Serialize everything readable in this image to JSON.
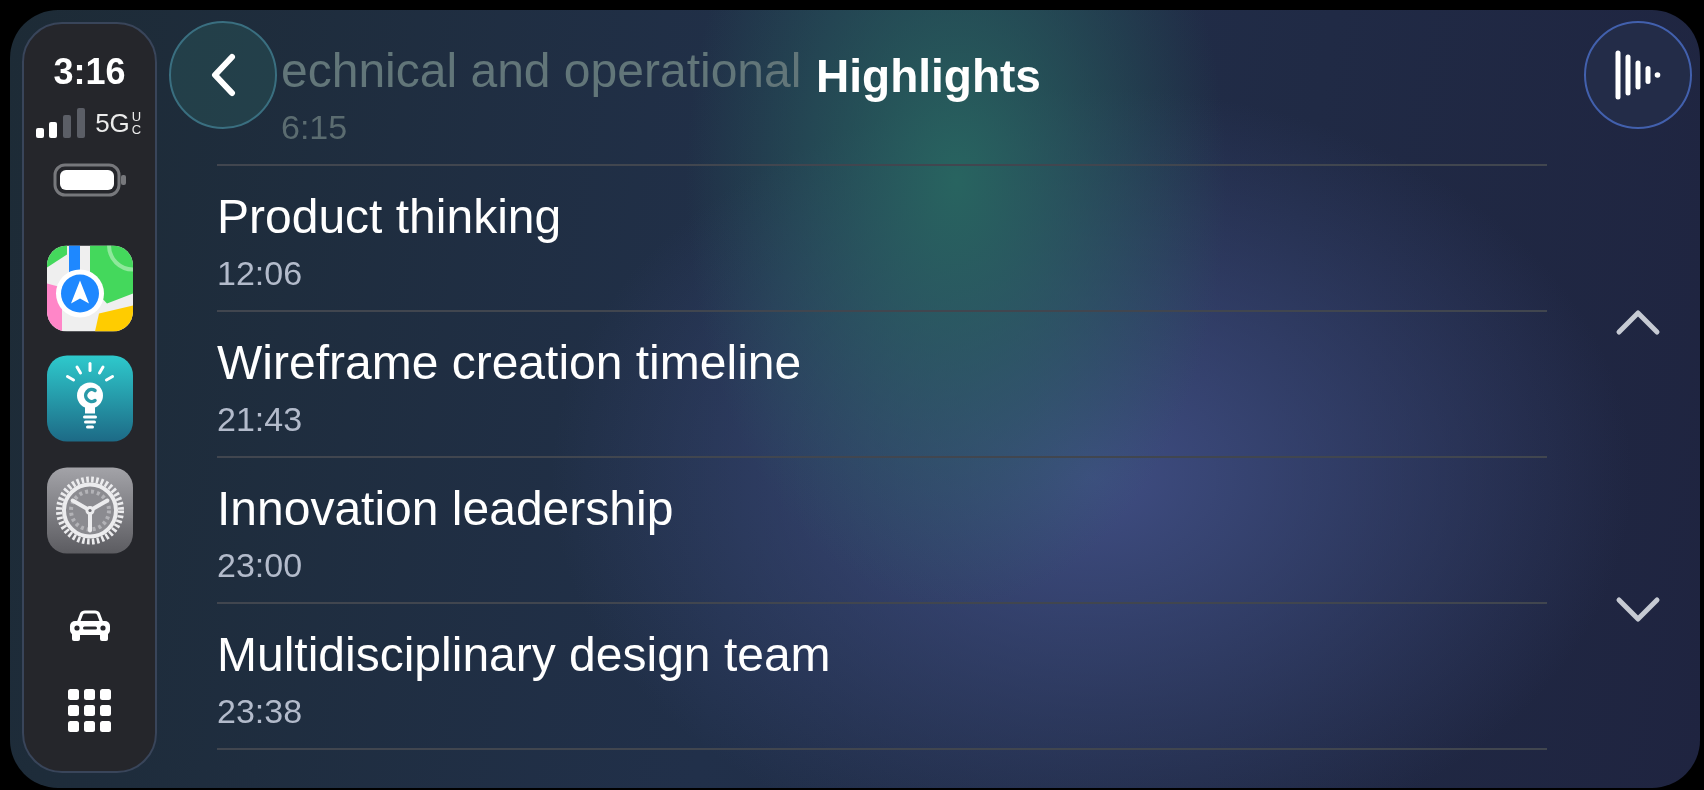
{
  "sidebar": {
    "time": "3:16",
    "network": "5G",
    "network_badge": "UC"
  },
  "header": {
    "title": "Highlights"
  },
  "highlights": [
    {
      "kind": "faded",
      "title": "echnical and operational",
      "time": "6:15"
    },
    {
      "kind": "item",
      "title": "Product thinking",
      "time": "12:06"
    },
    {
      "kind": "item",
      "title": "Wireframe creation timeline",
      "time": "21:43"
    },
    {
      "kind": "item",
      "title": "Innovation leadership",
      "time": "23:00"
    },
    {
      "kind": "item",
      "title": "Multidisciplinary design team",
      "time": "23:38"
    }
  ]
}
